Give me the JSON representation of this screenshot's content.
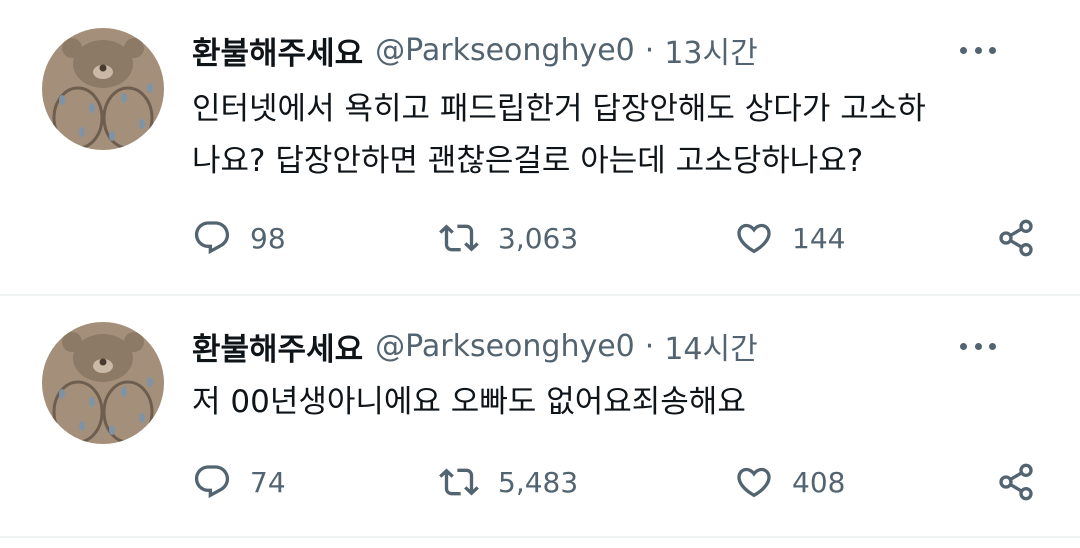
{
  "colors": {
    "text_primary": "#0f1419",
    "text_secondary": "#536471",
    "divider": "#eff3f4",
    "avatar_bg": "#a4907a"
  },
  "tweets": [
    {
      "display_name": "환불해주세요",
      "handle": "@Parkseonghye0",
      "separator": "·",
      "time": "13시간",
      "text_lines": [
        "인터넷에서 욕히고 패드립한거 답장안해도 상다가 고소하",
        "나요?  답장안하면 괜찮은걸로 아는데 고소당하나요?"
      ],
      "replies": "98",
      "retweets": "3,063",
      "likes": "144",
      "icons": {
        "avatar": "bear-avatar",
        "more": "more-options-icon",
        "reply": "reply-icon",
        "retweet": "retweet-icon",
        "like": "heart-icon",
        "share": "share-icon"
      }
    },
    {
      "display_name": "환불해주세요",
      "handle": "@Parkseonghye0",
      "separator": "·",
      "time": "14시간",
      "text_lines": [
        "저 00년생아니에요 오빠도 없어요죄송해요"
      ],
      "replies": "74",
      "retweets": "5,483",
      "likes": "408",
      "icons": {
        "avatar": "bear-avatar",
        "more": "more-options-icon",
        "reply": "reply-icon",
        "retweet": "retweet-icon",
        "like": "heart-icon",
        "share": "share-icon"
      }
    }
  ]
}
